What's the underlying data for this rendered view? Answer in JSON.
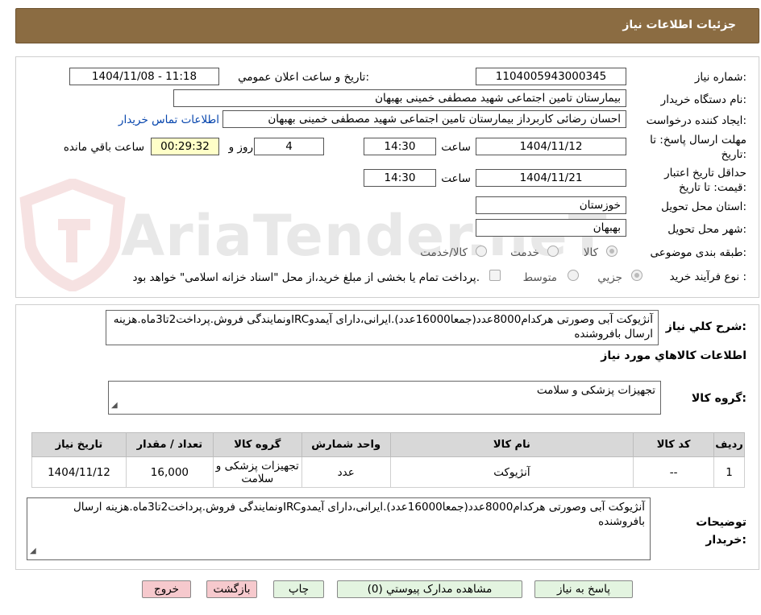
{
  "header": {
    "title": "جزئیات اطلاعات نیاز"
  },
  "labels": {
    "need_number": "شماره نیاز:",
    "announce_datetime": "تاریخ و ساعت اعلان عمومي:",
    "buyer_org": "نام دستگاه خريدار:",
    "requester": "ايجاد کننده درخواست:",
    "contact_link": "اطلاعات تماس خریدار",
    "response_deadline": "مهلت ارسال پاسخ: تا تاریخ:",
    "time": "ساعت",
    "days_and": "روز و",
    "remaining": "ساعت باقي مانده",
    "price_validity": "حداقل تاريخ اعتبار قیمت: تا تاریخ:",
    "province": "استان محل تحويل:",
    "city": "شهر محل تحويل:",
    "category": "طبقه بندی موضوعی:",
    "process_type": "نوع فرآيند خريد :",
    "general_desc": "شرح کلي نياز:",
    "goods_info": "اطلاعات کالاهاي مورد نياز",
    "goods_group": "گروه کالا:",
    "buyer_notes": "توضيحات خريدار:"
  },
  "values": {
    "need_number": "1104005943000345",
    "announce_datetime": "1404/11/08 - 11:18",
    "buyer_org": "بیمارستان تامین اجتماعی شهید مصطفی خمینی بهبهان",
    "requester": "احسان رضائی کاربرداز بیمارستان تامین اجتماعی شهید مصطفی خمینی بهبهان",
    "response_date": "1404/11/12",
    "response_time": "14:30",
    "days": "4",
    "remaining_time": "00:29:32",
    "validity_date": "1404/11/21",
    "validity_time": "14:30",
    "province": "خوزستان",
    "city": "بهبهان",
    "general_desc": "آنژیوکت آبی وصورتی هرکدام8000عدد(جمعا16000عدد).ایرانی،دارای آیمدوIRCونمایندگی فروش.پرداخت2تا3ماه.هزینه ارسال بافروشنده",
    "goods_group": "تجهیزات پزشکی و سلامت",
    "buyer_notes": "آنژیوکت آبی وصورتی هرکدام8000عدد(جمعا16000عدد).ایرانی،دارای آیمدوIRCونمایندگی فروش.پرداخت2تا3ماه.هزینه ارسال بافروشنده"
  },
  "category_options": {
    "goods": "کالا",
    "service": "خدمت",
    "goods_service": "کالا/خدمت"
  },
  "process_options": {
    "minor": "جزیي",
    "medium": "متوسط",
    "treasury_note": "پرداخت تمام یا بخشی از مبلغ خرید،از محل \"اسناد خزانه اسلامی\" خواهد بود."
  },
  "table": {
    "headers": [
      "ردیف",
      "کد کالا",
      "نام کالا",
      "واحد شمارش",
      "گروه کالا",
      "تعداد / مقدار",
      "تاریخ نیاز"
    ],
    "rows": [
      [
        "1",
        "--",
        "آنژیوکت",
        "عدد",
        "تجهیزات پزشکی و سلامت",
        "16,000",
        "1404/11/12"
      ]
    ]
  },
  "buttons": {
    "reply": "پاسخ به نیاز",
    "attachments": "مشاهده مدارک پیوستي (0)",
    "print": "چاپ",
    "back": "بازگشت",
    "exit": "خروج"
  },
  "watermark": {
    "text": "AriaTender.neT"
  }
}
